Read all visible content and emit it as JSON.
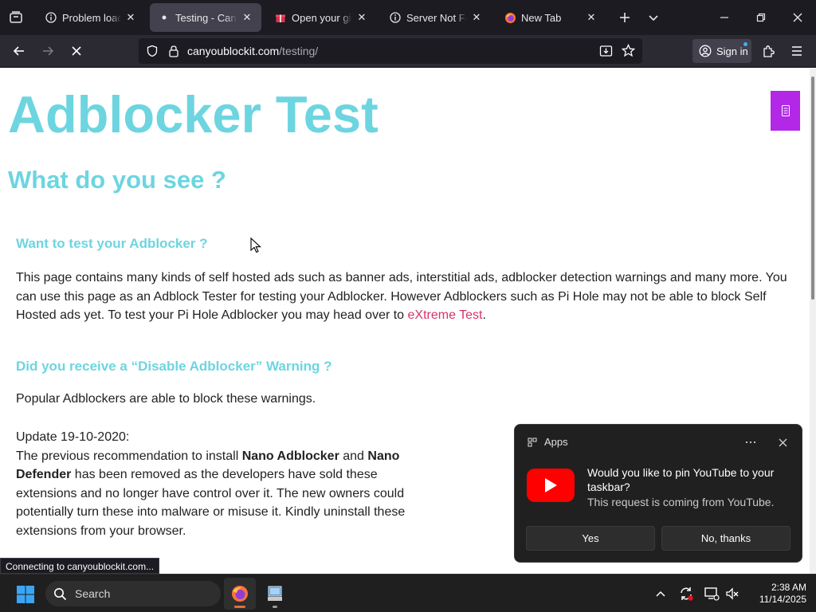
{
  "browser": {
    "tabs": [
      {
        "title": "Problem loading page",
        "icon": "info-icon",
        "active": false
      },
      {
        "title": "Testing - Can You Block It",
        "icon": "dot-icon",
        "active": true
      },
      {
        "title": "Open your gift - ",
        "icon": "gift-icon",
        "active": false
      },
      {
        "title": "Server Not Found",
        "icon": "info-icon",
        "active": false
      },
      {
        "title": "New Tab",
        "icon": "firefox-icon",
        "active": false
      }
    ],
    "url_domain": "canyoublockit.com",
    "url_path": "/testing/",
    "sign_in_label": "Sign in",
    "status_text": "Connecting to canyoublockit.com..."
  },
  "page": {
    "title": "Adblocker Test",
    "subtitle": "What do you see ?",
    "section1_heading": "Want to test your Adblocker ?",
    "section1_text": "This page contains many kinds of self hosted ads such as banner ads, interstitial ads, adblocker detection warnings and many more. You can use this page as an Adblock Tester for testing your Adblocker. However Adblockers such as Pi Hole may not be able to block Self Hosted ads yet. To test your Pi Hole Adblocker you may head over to ",
    "section1_link": "eXtreme Test",
    "section1_end": ".",
    "section2_heading": "Did you receive a “Disable Adblocker” Warning ?",
    "section2_text": "Popular Adblockers are able to block these warnings.",
    "update_date": "Update 19-10-2020:",
    "update_text_1": "The previous recommendation to install ",
    "update_bold_1": "Nano Adblocker",
    "update_text_2": " and ",
    "update_bold_2": "Nano Defender",
    "update_text_3": " has been removed as the developers have sold these extensions and no longer have control over it. The new owners could potentially turn these into malware or misuse it. Kindly uninstall these extensions from your browser."
  },
  "notification": {
    "app_name": "Apps",
    "message": "Would you like to pin YouTube to your taskbar?",
    "sub": "This request is coming from YouTube.",
    "yes_label": "Yes",
    "no_label": "No, thanks"
  },
  "taskbar": {
    "search_label": "Search",
    "time": "2:38 AM",
    "date": "11/14/2025"
  },
  "colors": {
    "heading": "#6dd5e0",
    "link": "#d6336c",
    "widget": "#b228e6",
    "youtube": "#ff0000"
  }
}
